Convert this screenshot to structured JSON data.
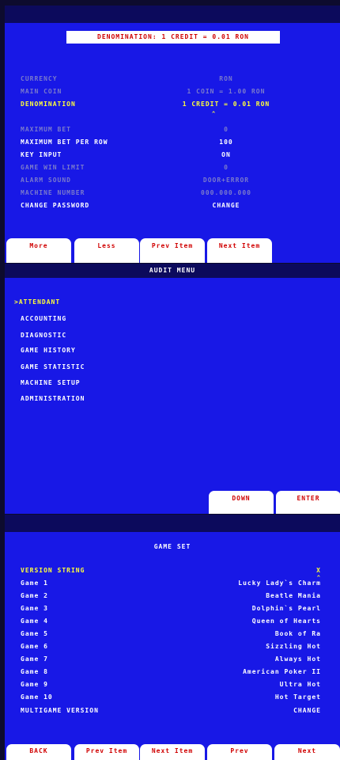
{
  "screen1": {
    "header": "DENOMINATION: 1 CREDIT = 0.01 RON",
    "rows": [
      {
        "label": "CURRENCY",
        "value": "RON",
        "state": "disabled"
      },
      {
        "label": "MAIN COIN",
        "value": "1 COIN = 1.00 RON",
        "state": "disabled"
      },
      {
        "label": "DENOMINATION",
        "value": "1 CREDIT = 0.01 RON",
        "state": "selected",
        "marker": "^"
      },
      {
        "label": "MAXIMUM BET",
        "value": "0",
        "state": "disabled"
      },
      {
        "label": "MAXIMUM BET PER ROW",
        "value": "100",
        "state": "normal"
      },
      {
        "label": "KEY INPUT",
        "value": "ON",
        "state": "normal"
      },
      {
        "label": "GAME WIN LIMIT",
        "value": "0",
        "state": "disabled"
      },
      {
        "label": "ALARM SOUND",
        "value": "DOOR+ERROR",
        "state": "disabled"
      },
      {
        "label": "MACHINE NUMBER",
        "value": "000.000.000",
        "state": "disabled"
      },
      {
        "label": "CHANGE PASSWORD",
        "value": "CHANGE",
        "state": "normal"
      }
    ],
    "buttons": [
      "More",
      "Less",
      "Prev Item",
      "Next Item"
    ]
  },
  "screen2": {
    "title": "AUDIT MENU",
    "items": [
      ">ATTENDANT",
      "ACCOUNTING",
      "DIAGNOSTIC",
      "GAME HISTORY",
      "GAME STATISTIC",
      "MACHINE SETUP",
      "ADMINISTRATION"
    ],
    "buttons": [
      "DOWN",
      "ENTER"
    ]
  },
  "screen3": {
    "title": "GAME SET",
    "version_label": "VERSION STRING",
    "version_value": "X",
    "version_marker": "^",
    "games": [
      {
        "label": "Game 1",
        "value": "Lucky Lady`s Charm"
      },
      {
        "label": "Game 2",
        "value": "Beatle Mania"
      },
      {
        "label": "Game 3",
        "value": "Dolphin`s Pearl"
      },
      {
        "label": "Game 4",
        "value": "Queen of Hearts"
      },
      {
        "label": "Game 5",
        "value": "Book of Ra"
      },
      {
        "label": "Game 6",
        "value": "Sizzling Hot"
      },
      {
        "label": "Game 7",
        "value": "Always Hot"
      },
      {
        "label": "Game 8",
        "value": "American Poker II"
      },
      {
        "label": "Game 9",
        "value": "Ultra Hot"
      },
      {
        "label": "Game 10",
        "value": "Hot Target"
      }
    ],
    "multigame_label": "MULTIGAME VERSION",
    "multigame_value": "CHANGE",
    "buttons": [
      "BACK",
      "Prev Item",
      "Next Item",
      "Prev",
      "Next"
    ]
  },
  "colors": {
    "screen_bg": "#1818e6",
    "bar": "#0c0a5c",
    "selected": "#ffff3a",
    "disabled": "#7a7acc",
    "button_text": "#d00000"
  }
}
